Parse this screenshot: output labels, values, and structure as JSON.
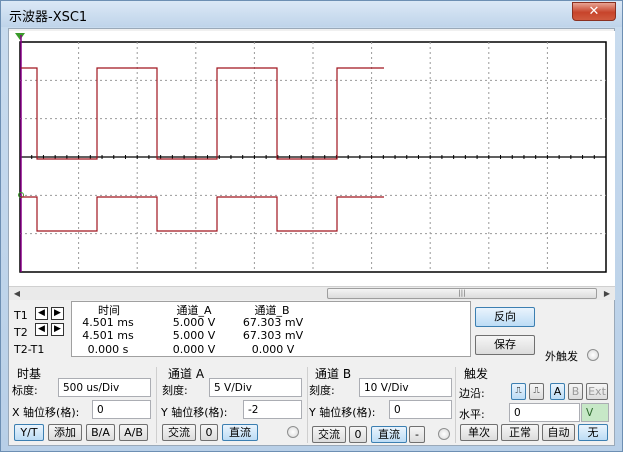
{
  "window": {
    "title": "示波器-XSC1",
    "close_label": "✕"
  },
  "screen": {
    "trace_color": "#a0141e",
    "trigger_marker_color": "#8b008b"
  },
  "cursors": {
    "t1_label": "T1",
    "t2_label": "T2",
    "t21_label": "T2-T1",
    "left_arrow": "◀",
    "right_arrow": "▶",
    "headers": {
      "time": "时间",
      "channel_a": "通道_A",
      "channel_b": "通道_B"
    },
    "rows": [
      {
        "time": "4.501 ms",
        "a": "5.000 V",
        "b": "67.303 mV"
      },
      {
        "time": "4.501 ms",
        "a": "5.000 V",
        "b": "67.303 mV"
      },
      {
        "time": "0.000 s",
        "a": "0.000 V",
        "b": "0.000 V"
      }
    ]
  },
  "actions": {
    "reverse": "反向",
    "save": "保存",
    "ext_trigger": "外触发"
  },
  "timebase": {
    "title": "时基",
    "scale_label": "标度:",
    "scale_value": "500 us/Div",
    "xpos_label": "X 轴位移(格):",
    "xpos_value": "0",
    "modes": [
      "Y/T",
      "添加",
      "B/A",
      "A/B"
    ]
  },
  "channel_a": {
    "title": "通道 A",
    "scale_label": "刻度:",
    "scale_value": "5  V/Div",
    "ypos_label": "Y 轴位移(格):",
    "ypos_value": "-2",
    "coupling": [
      "交流",
      "0",
      "直流"
    ]
  },
  "channel_b": {
    "title": "通道 B",
    "scale_label": "刻度:",
    "scale_value": "10  V/Div",
    "ypos_label": "Y 轴位移(格):",
    "ypos_value": "0",
    "coupling": [
      "交流",
      "0",
      "直流",
      "-"
    ]
  },
  "trigger": {
    "title": "触发",
    "edge_label": "边沿:",
    "level_label": "水平:",
    "level_value": "0",
    "level_unit": "V",
    "edge_buttons": [
      "A",
      "B",
      "Ext"
    ],
    "modes": [
      "单次",
      "正常",
      "自动",
      "无"
    ]
  }
}
